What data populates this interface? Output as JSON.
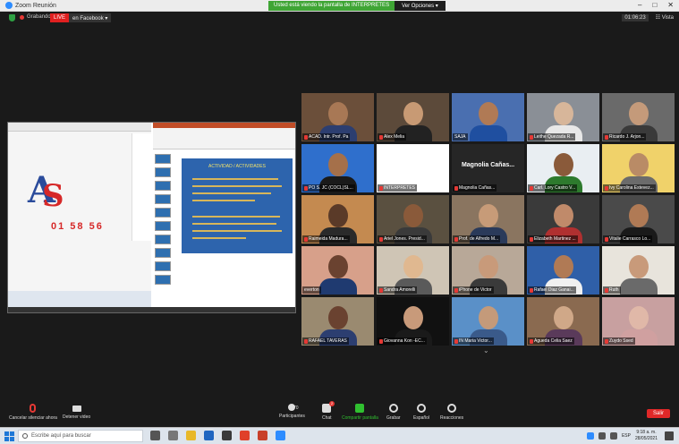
{
  "window": {
    "title": "Zoom Reunión",
    "minimize": "–",
    "maximize": "□",
    "close": "✕"
  },
  "share_banner": {
    "message": "Usted está viendo la pantalla de INTERPRETES",
    "options_label": "Ver Opciones ▾"
  },
  "meeting_bar": {
    "recording_label": "Grabando",
    "live_badge": "LIVE",
    "live_target": "en Facebook ▾",
    "timer": "01:06:23",
    "view_label": "Vista"
  },
  "shared_screen": {
    "logo_number": "01 58 56",
    "slide_title": "ACTIVIDAD / ACTIVIDADES"
  },
  "gallery": {
    "tiles": [
      {
        "name": "ACAD. Intr. Prof. Pa",
        "muted": true,
        "bg": "#6b4f3a",
        "skin": "#a87855",
        "shirt": "#2c3e70",
        "speaking": false
      },
      {
        "name": "Alex Melia",
        "muted": true,
        "bg": "#5c4a3a",
        "skin": "#c89a74",
        "shirt": "#222222",
        "speaking": false
      },
      {
        "name": "SAJA",
        "muted": false,
        "bg": "#4a6fb0",
        "skin": "#b07a55",
        "shirt": "#1f4fa0",
        "speaking": false
      },
      {
        "name": "Leithe Quezada R...",
        "muted": true,
        "bg": "#8a8f96",
        "skin": "#d7b69a",
        "shirt": "#e8e8e8",
        "speaking": false
      },
      {
        "name": "Ricardo J. Arjon...",
        "muted": true,
        "bg": "#6a6a6a",
        "skin": "#c49a7a",
        "shirt": "#3a3a3a",
        "speaking": false
      },
      {
        "name": "PO S. JC (COCL)SL...",
        "muted": true,
        "bg": "#2f6fcc",
        "skin": "#a5704a",
        "shirt": "#1a1a1a",
        "speaking": false
      },
      {
        "name": "INTERPRETES",
        "muted": true,
        "bg": "#ffffff",
        "skin": "#ffffff",
        "shirt": "#ffffff",
        "speaking": false
      },
      {
        "name": "Magnolia Cañas...",
        "muted": true,
        "bg": "#262626",
        "skin": "#262626",
        "shirt": "#262626",
        "speaking": false,
        "name_only": true
      },
      {
        "name": "Carl. Lory Castro V...",
        "muted": true,
        "bg": "#e9eef2",
        "skin": "#8a5a3a",
        "shirt": "#2d7a2d",
        "speaking": false
      },
      {
        "name": "Ivy Carolina Estevez...",
        "muted": true,
        "bg": "#f0d26a",
        "skin": "#b98b66",
        "shirt": "#6b6b6b",
        "speaking": false
      },
      {
        "name": "Raimeida Madura...",
        "muted": true,
        "bg": "#c48a50",
        "skin": "#5a3a28",
        "shirt": "#2a2a2a",
        "speaking": false
      },
      {
        "name": "Ariel Jones. Presid...",
        "muted": true,
        "bg": "#5a5040",
        "skin": "#8a5a3a",
        "shirt": "#3a3a3a",
        "speaking": false
      },
      {
        "name": "Prof. de Alfredo M...",
        "muted": true,
        "bg": "#8a7560",
        "skin": "#c79b78",
        "shirt": "#2a3a5a",
        "speaking": false
      },
      {
        "name": "Elizabeth Martinez ...",
        "muted": true,
        "bg": "#3a3a3a",
        "skin": "#c08a6a",
        "shirt": "#b03030",
        "speaking": false
      },
      {
        "name": "Vitalie Carrasco Lo...",
        "muted": true,
        "bg": "#4a4a4a",
        "skin": "#b07a55",
        "shirt": "#1a1a1a",
        "speaking": false
      },
      {
        "name": "everton",
        "muted": false,
        "bg": "#d7a08a",
        "skin": "#6a4230",
        "shirt": "#1f3a70",
        "speaking": true
      },
      {
        "name": "Sandra Amorelli",
        "muted": true,
        "bg": "#cfc5b5",
        "skin": "#e0b890",
        "shirt": "#5a5a5a",
        "speaking": false
      },
      {
        "name": "iPhone de Victor",
        "muted": true,
        "bg": "#b8a898",
        "skin": "#c89a7a",
        "shirt": "#3a3a3a",
        "speaking": false
      },
      {
        "name": "Rafael Diaz Ganai...",
        "muted": true,
        "bg": "#2f5fa8",
        "skin": "#b07a55",
        "shirt": "#f0f0f0",
        "speaking": false
      },
      {
        "name": "Ruth",
        "muted": true,
        "bg": "#e8e4dc",
        "skin": "#c89a7a",
        "shirt": "#6a6a6a",
        "speaking": false
      },
      {
        "name": "RAFAEL TAVERAS",
        "muted": true,
        "bg": "#9a8a70",
        "skin": "#6a4230",
        "shirt": "#2c3e70",
        "speaking": false
      },
      {
        "name": "Giovanna Kon -EC...",
        "muted": true,
        "bg": "#111111",
        "skin": "#c89a7a",
        "shirt": "#1a1a1a",
        "speaking": false
      },
      {
        "name": "IN Maria Victor...",
        "muted": true,
        "bg": "#5a90c8",
        "skin": "#c49a7a",
        "shirt": "#3a5a8a",
        "speaking": false
      },
      {
        "name": "Agueda Celia Saez",
        "muted": true,
        "bg": "#8a6a50",
        "skin": "#d0a888",
        "shirt": "#5a3a5a",
        "speaking": false
      },
      {
        "name": "Zuydo Ssed",
        "muted": true,
        "bg": "#c8a0a0",
        "skin": "#e0b8a8",
        "shirt": "#d0a0a0",
        "speaking": false
      }
    ]
  },
  "toolbar": {
    "mute_label": "Cancelar silenciar ahora",
    "video_label": "Detener video",
    "participants_label": "Participantes",
    "participants_count": "70",
    "chat_label": "Chat",
    "chat_count": "2",
    "share_label": "Compartir pantalla",
    "record_label": "Grabar",
    "language_label": "Español",
    "reactions_label": "Reacciones",
    "leave_label": "Salir"
  },
  "taskbar": {
    "search_placeholder": "Escribe aquí para buscar",
    "language": "ESP",
    "time": "9:18 a. m.",
    "date": "28/05/2021"
  },
  "colors": {
    "accent_green": "#30c030",
    "live_red": "#e02020",
    "zoom_blue": "#2d8cff"
  }
}
